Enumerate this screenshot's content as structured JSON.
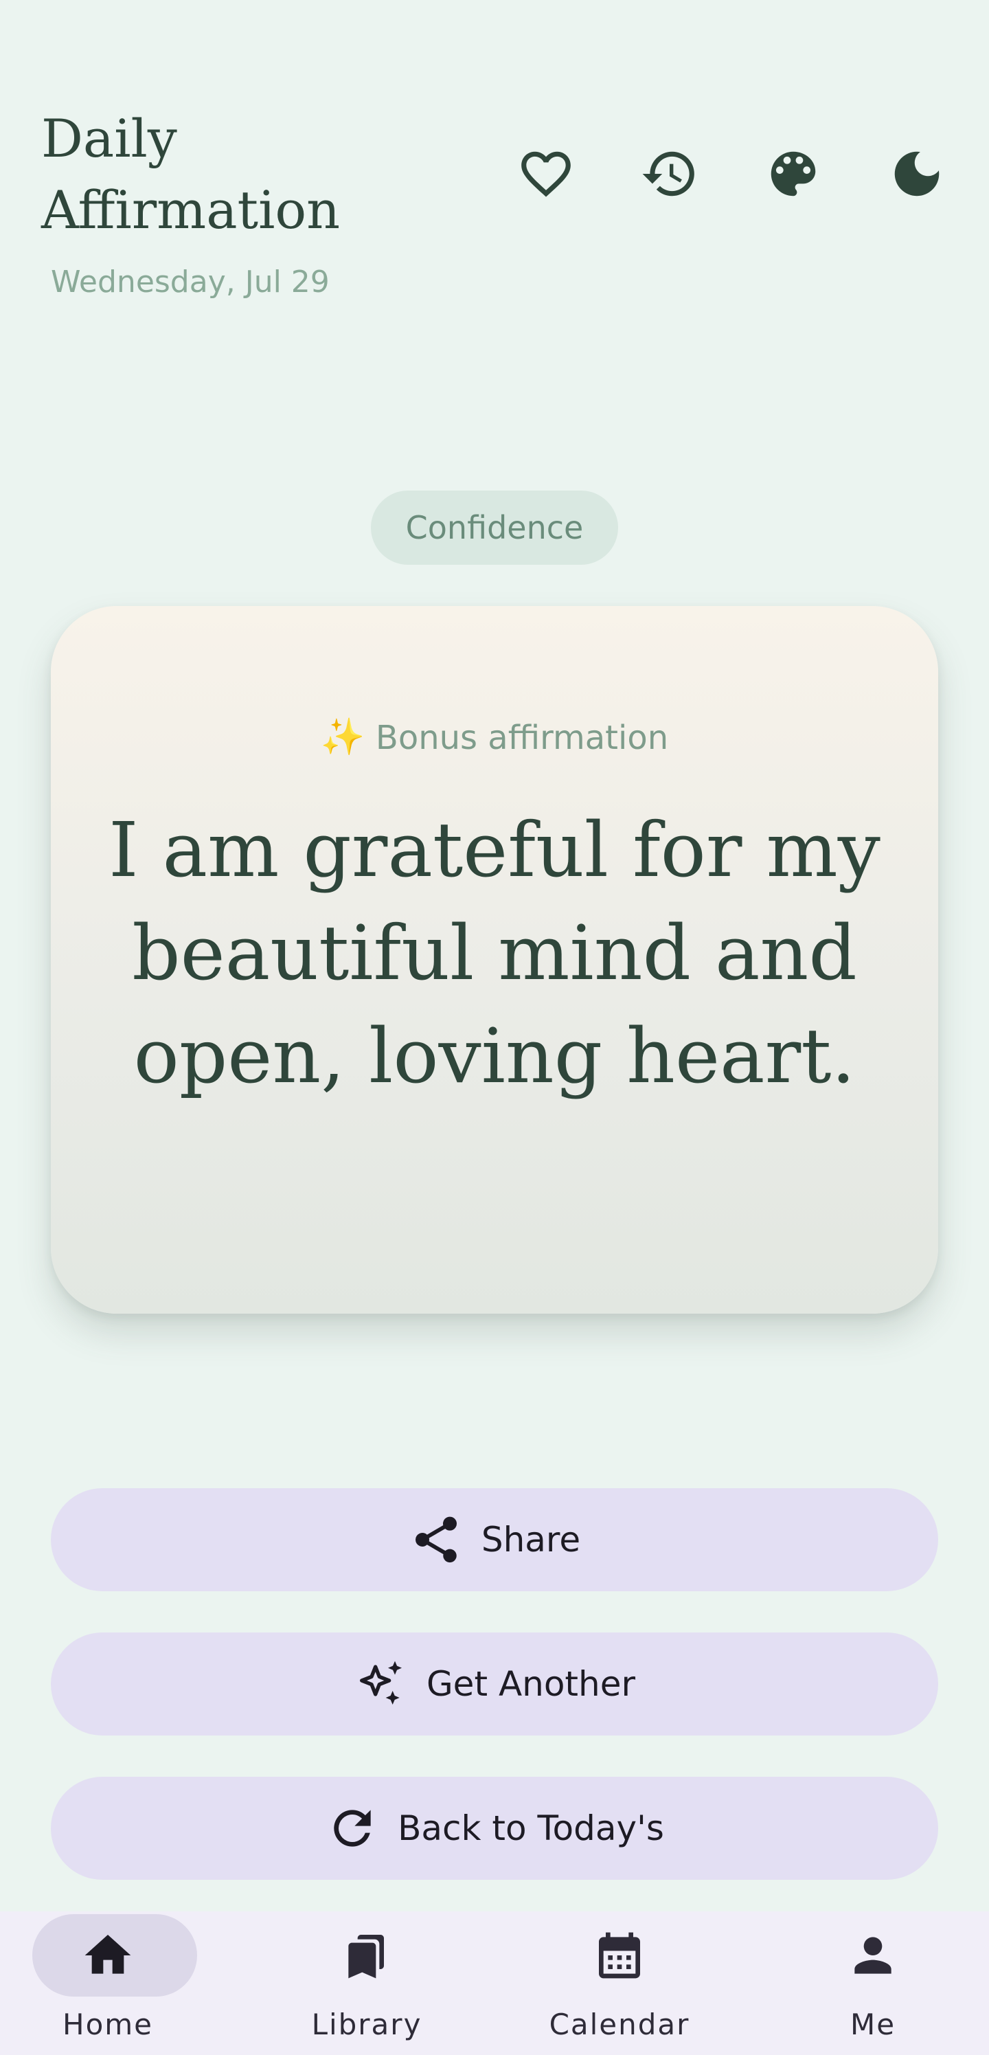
{
  "header": {
    "title": "Daily Affirmation",
    "date": "Wednesday, Jul 29",
    "icons": [
      "heart-outline-icon",
      "history-icon",
      "palette-icon",
      "moon-icon"
    ]
  },
  "category_chip": "Confidence",
  "card": {
    "bonus_emoji": "✨",
    "bonus_label": "Bonus affirmation",
    "affirmation": "I am grateful for my beautiful mind and open, loving heart."
  },
  "actions": {
    "share": "Share",
    "get_another": "Get Another",
    "back_today": "Back to Today's"
  },
  "nav": {
    "items": [
      {
        "label": "Home",
        "icon": "home-icon",
        "selected": true
      },
      {
        "label": "Library",
        "icon": "library-icon",
        "selected": false
      },
      {
        "label": "Calendar",
        "icon": "calendar-icon",
        "selected": false
      },
      {
        "label": "Me",
        "icon": "person-icon",
        "selected": false
      }
    ]
  },
  "colors": {
    "background": "#ebf4f0",
    "text_primary": "#2f463b",
    "text_muted": "#8aaa98",
    "button_bg": "#e3dff3",
    "nav_bg": "#f1eef8",
    "nav_selected": "#dcd8e9"
  }
}
